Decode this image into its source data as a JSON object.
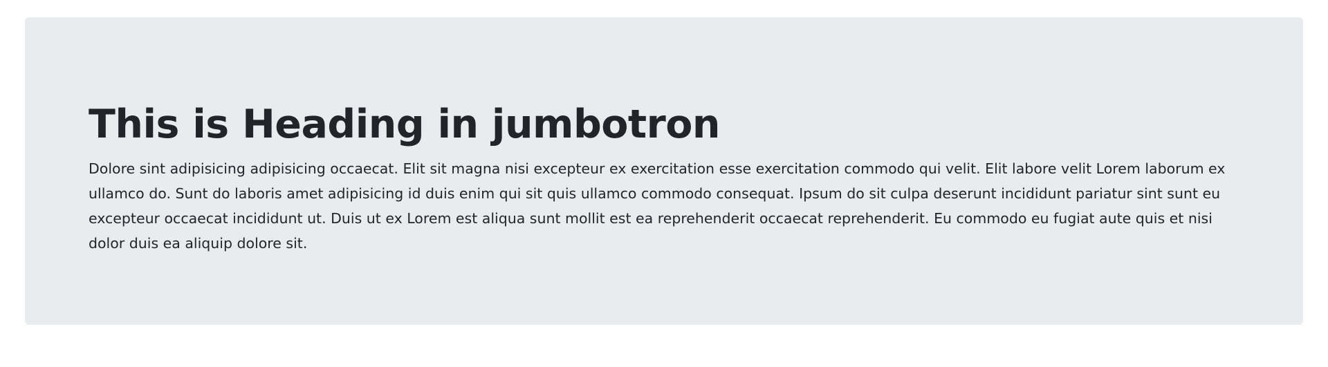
{
  "jumbotron": {
    "heading": "This is Heading in jumbotron",
    "body": "Dolore sint adipisicing adipisicing occaecat. Elit sit magna nisi excepteur ex exercitation esse exercitation commodo qui velit. Elit labore velit Lorem laborum ex ullamco do. Sunt do laboris amet adipisicing id duis enim qui sit quis ullamco commodo consequat. Ipsum do sit culpa deserunt incididunt pariatur sint sunt eu excepteur occaecat incididunt ut. Duis ut ex Lorem est aliqua sunt mollit est ea reprehenderit occaecat reprehenderit. Eu commodo eu fugiat aute quis et nisi dolor duis ea aliquip dolore sit."
  },
  "colors": {
    "jumbotron_background": "#e9ecef",
    "text": "#212529",
    "page_background": "#ffffff"
  }
}
